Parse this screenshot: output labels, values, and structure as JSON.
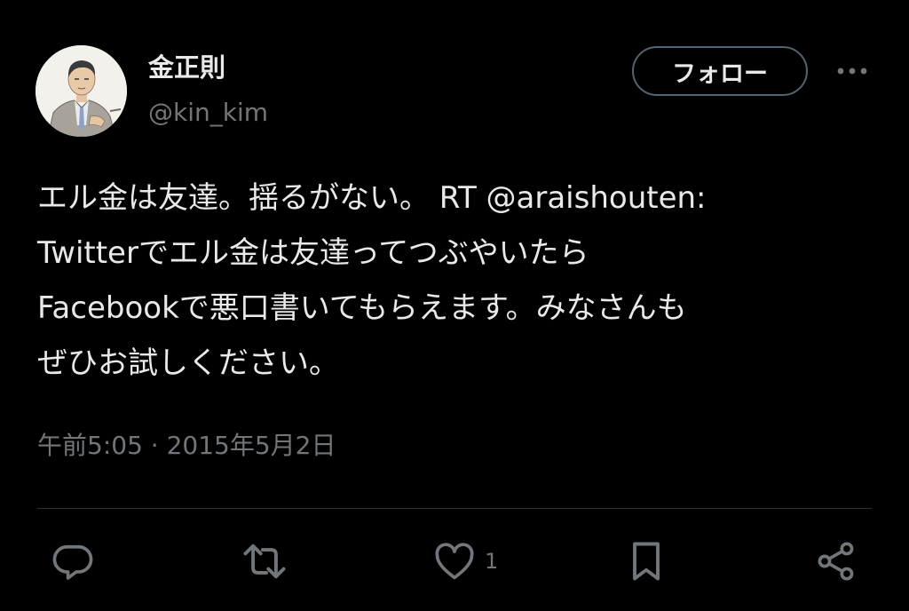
{
  "author": {
    "display_name": "金正則",
    "handle": "@kin_kim"
  },
  "header": {
    "follow_label": "フォロー",
    "more_icon": "more-horizontal-icon"
  },
  "tweet": {
    "lines": [
      "エル金は友達。揺るがない。 RT @araishouten:",
      "Twitterでエル金は友達ってつぶやいたら",
      "Facebookで悪口書いてもらえます。みなさんも",
      "ぜひお試しください。"
    ],
    "timestamp": "午前5:05 · 2015年5月2日"
  },
  "actions": {
    "reply_icon": "reply-icon",
    "retweet_icon": "retweet-icon",
    "like_icon": "heart-icon",
    "like_count": "1",
    "bookmark_icon": "bookmark-icon",
    "share_icon": "share-icon"
  },
  "colors": {
    "background": "#000000",
    "primary_text": "#e7e9ea",
    "secondary_text": "#71767b",
    "divider": "#2f3336",
    "follow_border": "#536471"
  }
}
